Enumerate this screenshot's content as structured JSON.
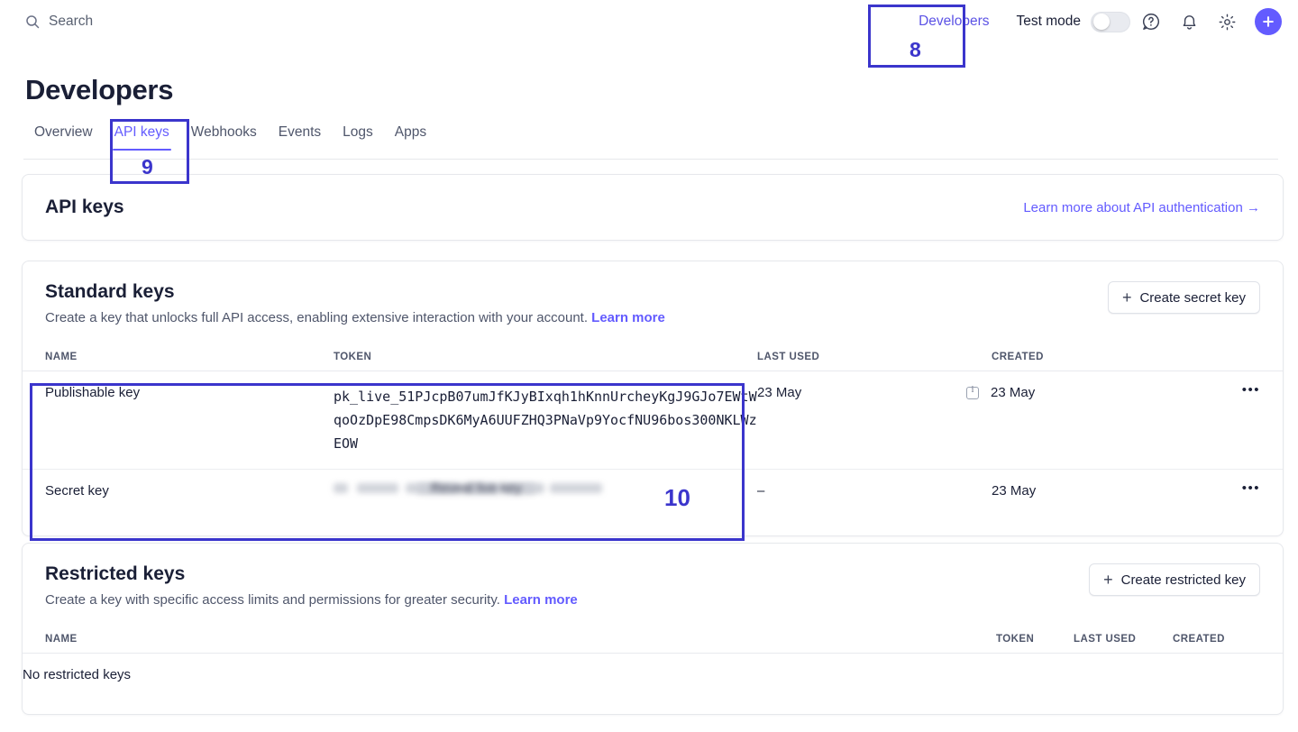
{
  "topbar": {
    "search_label": "Search",
    "search_icon": "search-icon",
    "developers_link": "Developers",
    "test_mode_label": "Test mode",
    "toggle_state": "off",
    "help_icon": "help-circle-icon",
    "notifications_icon": "bell-icon",
    "settings_icon": "gear-icon",
    "add_icon": "plus-icon"
  },
  "page": {
    "title": "Developers",
    "tabs": [
      {
        "label": "Overview",
        "active": false
      },
      {
        "label": "API keys",
        "active": true
      },
      {
        "label": "Webhooks",
        "active": false
      },
      {
        "label": "Events",
        "active": false
      },
      {
        "label": "Logs",
        "active": false
      },
      {
        "label": "Apps",
        "active": false
      }
    ]
  },
  "api_keys_card": {
    "title": "API keys",
    "learn_more_link": "Learn more about API authentication →"
  },
  "standard_keys": {
    "title": "Standard keys",
    "description": "Create a key that unlocks full API access, enabling extensive interaction with your account.",
    "learn_more": "Learn more",
    "create_button": "Create secret key",
    "create_button_icon": "plus-icon",
    "columns": [
      "NAME",
      "TOKEN",
      "LAST USED",
      "CREATED"
    ],
    "rows": [
      {
        "name": "Publishable key",
        "token": "pk_live_51PJcpB07umJfKJyBIxqh1hKnnUrcheyKgJ9GJo7EWtWqoOzDpE98CmpsDK6MyA6UUFZHQ3PNaVp9YocfNU96bos300NKLWzEOW",
        "token_masked": false,
        "last_used": "23 May",
        "created": "23 May",
        "created_has_info_icon": true,
        "menu_icon": "overflow-menu-icon"
      },
      {
        "name": "Secret key",
        "token": "",
        "token_masked": true,
        "reveal_button": "Reveal live key",
        "last_used": "–",
        "created": "23 May",
        "created_has_info_icon": false,
        "menu_icon": "overflow-menu-icon"
      }
    ]
  },
  "restricted_keys": {
    "title": "Restricted keys",
    "description": "Create a key with specific access limits and permissions for greater security.",
    "learn_more": "Learn more",
    "create_button": "Create restricted key",
    "create_button_icon": "plus-icon",
    "columns": [
      "NAME",
      "TOKEN",
      "LAST USED",
      "CREATED"
    ],
    "empty_message": "No restricted keys"
  },
  "annotations": {
    "color": "#3b35cc",
    "marks": [
      {
        "id": "8",
        "label": "8",
        "target": "developers-link"
      },
      {
        "id": "9",
        "label": "9",
        "target": "tab-api-keys"
      },
      {
        "id": "10",
        "label": "10",
        "target": "standard-keys-rows"
      }
    ]
  }
}
